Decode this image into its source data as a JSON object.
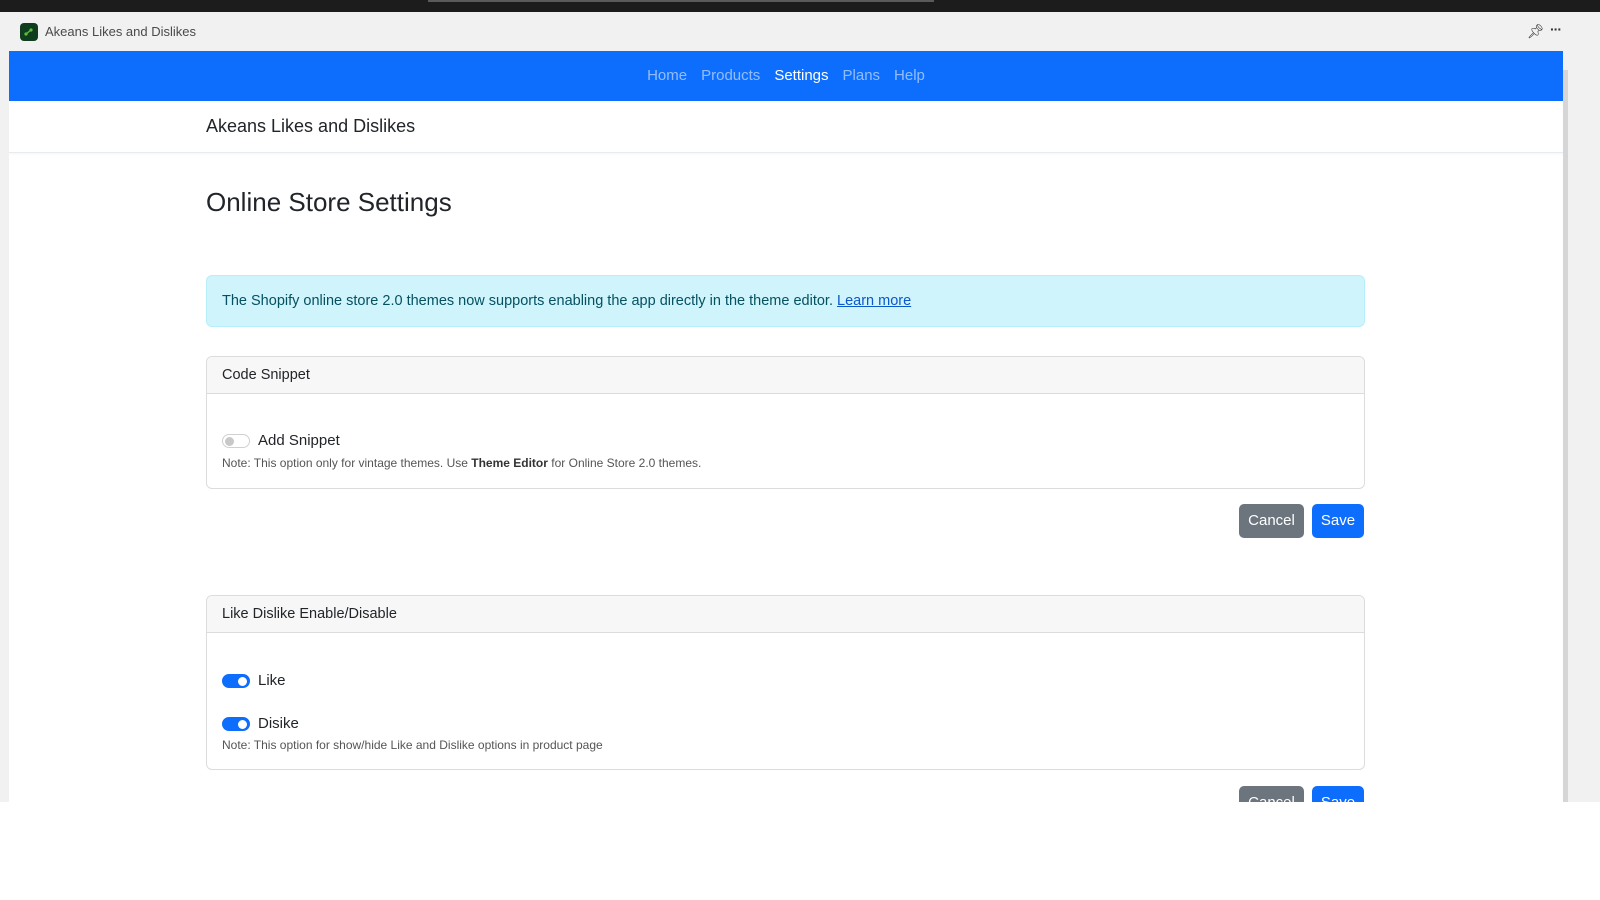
{
  "window": {
    "app_name": "Akeans Likes and Dislikes",
    "icons": {
      "logo": "app-logo-icon",
      "pin": "pin-icon",
      "more": "more-options-icon"
    }
  },
  "navbar": {
    "items": [
      {
        "label": "Home",
        "active": false
      },
      {
        "label": "Products",
        "active": false
      },
      {
        "label": "Settings",
        "active": true
      },
      {
        "label": "Plans",
        "active": false
      },
      {
        "label": "Help",
        "active": false
      }
    ],
    "color": "#0d6efd"
  },
  "subheader": {
    "title": "Akeans Likes and Dislikes"
  },
  "page": {
    "title": "Online Store Settings",
    "alert": {
      "text": "The Shopify online store 2.0 themes now supports enabling the app directly in the theme editor.",
      "link_label": "Learn more"
    }
  },
  "code_snippet_card": {
    "header": "Code Snippet",
    "toggle": {
      "label": "Add Snippet",
      "checked": false
    },
    "note_prefix": "Note: This option only for vintage themes. Use",
    "note_bold": "Theme Editor",
    "note_suffix": "for Online Store 2.0 themes.",
    "cancel_label": "Cancel",
    "save_label": "Save"
  },
  "like_dislike_card": {
    "header": "Like Dislike Enable/Disable",
    "toggles": [
      {
        "label": "Like",
        "checked": true
      },
      {
        "label": "Disike",
        "checked": true
      }
    ],
    "note": "Note: This option for show/hide Like and Dislike options in product page",
    "cancel_label": "Cancel",
    "save_label": "Save"
  },
  "colors": {
    "primary": "#0d6efd",
    "secondary": "#6c757d",
    "alert_bg": "#cff4fc"
  }
}
